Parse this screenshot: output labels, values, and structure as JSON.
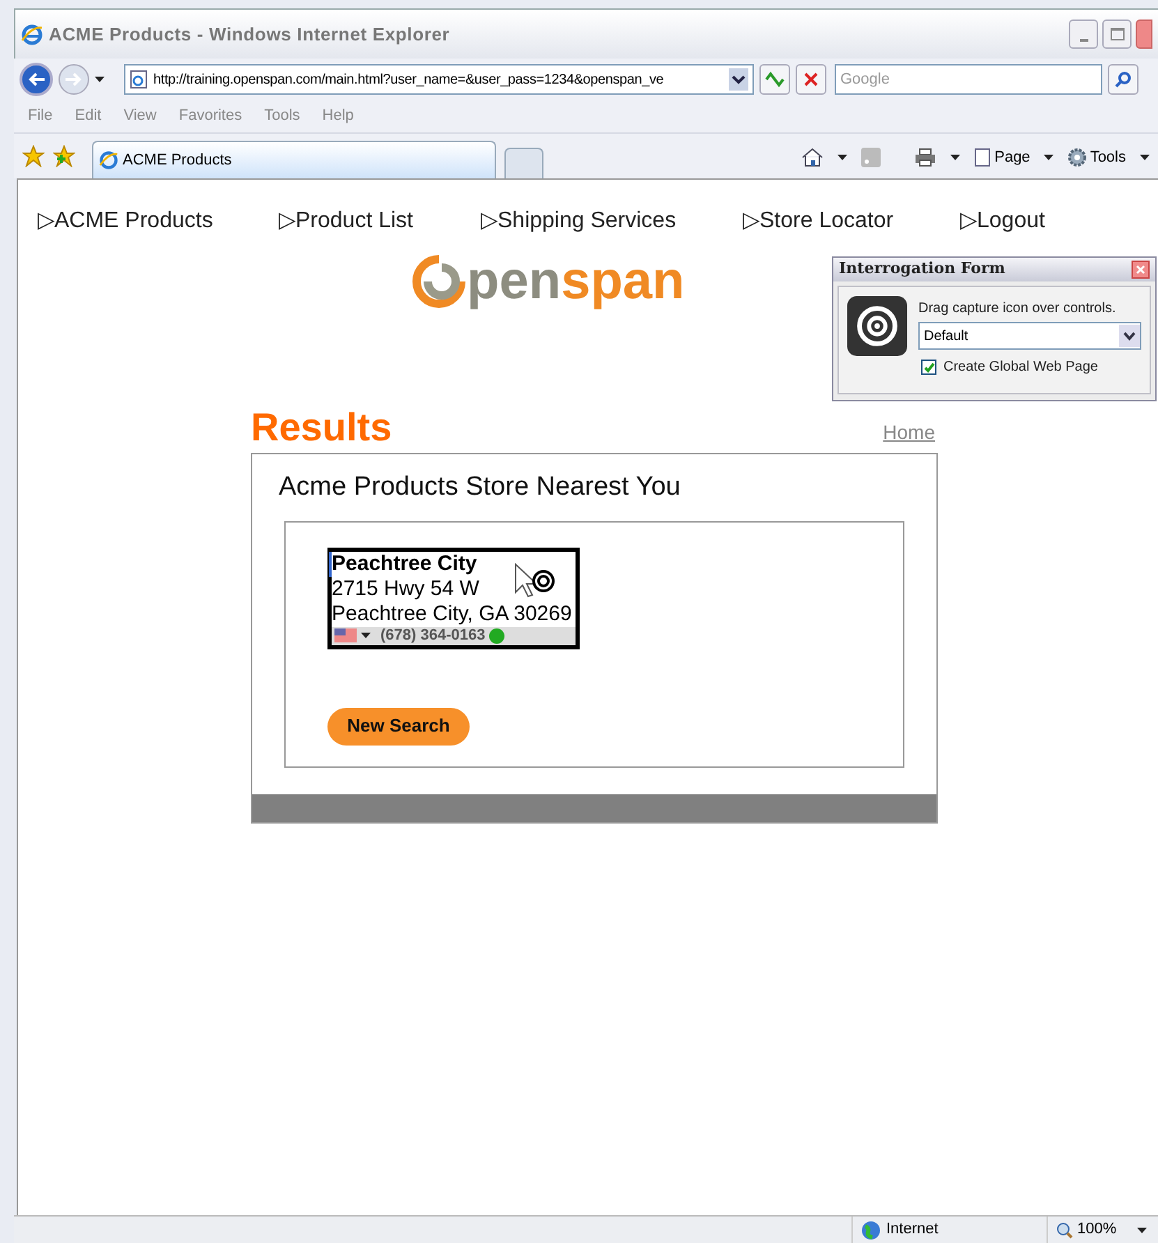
{
  "window": {
    "title": "ACME Products - Windows Internet Explorer"
  },
  "address_bar": {
    "url": "http://training.openspan.com/main.html?user_name=&user_pass=1234&openspan_ve"
  },
  "search": {
    "placeholder": "Google"
  },
  "menu": [
    "File",
    "Edit",
    "View",
    "Favorites",
    "Tools",
    "Help"
  ],
  "tabs": [
    {
      "label": "ACME Products",
      "selected": true
    }
  ],
  "command_bar": [
    "Page",
    "Tools"
  ],
  "nav": [
    "▷ACME Products",
    "▷Product List",
    "▷Shipping Services",
    "▷Store Locator",
    "▷Logout"
  ],
  "logo": {
    "text_1": "pen",
    "text_2": "span"
  },
  "interrogation_form": {
    "title": "Interrogation Form",
    "hint": "Drag capture icon over controls.",
    "dropdown": "Default",
    "checkbox": {
      "label": "Create Global Web Page",
      "checked": true
    }
  },
  "results": {
    "heading": "Results",
    "home_link": "Home",
    "panel_title": "Acme Products Store Nearest You",
    "store": {
      "name": "Peachtree City",
      "address": "2715 Hwy 54 W",
      "city": "Peachtree City, GA 30269",
      "phone": "(678) 364-0163"
    },
    "button": "New Search"
  },
  "status_bar": {
    "zone": "Internet",
    "zoom": "100%"
  }
}
